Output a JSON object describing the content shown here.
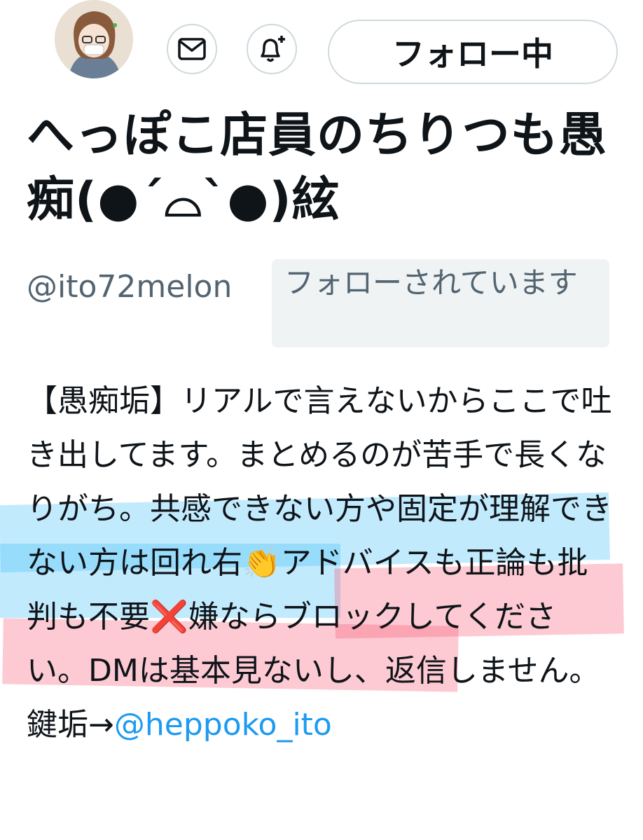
{
  "header": {
    "follow_button_label": "フォロー中",
    "message_icon": "envelope-icon",
    "notify_icon": "bell-plus-icon"
  },
  "profile": {
    "display_name": "へっぽこ店員のちりつも愚痴(●´⌓`●)絃",
    "handle": "@ito72melon",
    "follows_you": "フォローされています"
  },
  "bio": {
    "text": "【愚痴垢】リアルで言えないからここで吐き出してます。まとめるのが苦手で長くなりがち。共感できない方や固定が理解できない方は回れ右👏アドバイスも正論も批判も不要❌嫌ならブロックしてください。DMは基本見ないし、返信しません。鍵垢→",
    "mention": "@heppoko_ito"
  },
  "colors": {
    "link": "#1d9bf0",
    "secondary_text": "#536471",
    "highlight_blue": "#40bef8",
    "highlight_red": "#f7506c"
  }
}
